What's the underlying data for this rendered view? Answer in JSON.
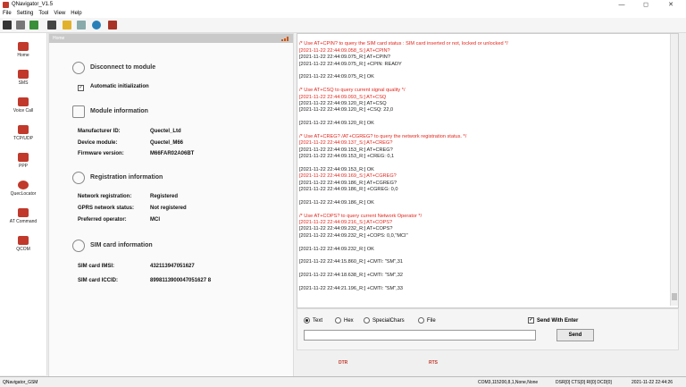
{
  "window": {
    "title": "QNavigator_V1.5",
    "minimize": "—",
    "maximize": "◻",
    "close": "✕"
  },
  "menu": [
    "File",
    "Setting",
    "Tool",
    "View",
    "Help"
  ],
  "sidebar": {
    "items": [
      {
        "label": "Home"
      },
      {
        "label": "SMS"
      },
      {
        "label": "Voice Call"
      },
      {
        "label": "TCP/UDP"
      },
      {
        "label": "PPP"
      },
      {
        "label": "QuecLocator"
      },
      {
        "label": "AT Command"
      },
      {
        "label": "QCOM"
      }
    ]
  },
  "home": {
    "header": "Home",
    "disconnect_label": "Disconnect to module",
    "auto_init_label": "Automatic initialization",
    "auto_init_checked": "✓",
    "module_info_title": "Module information",
    "module_fields": [
      {
        "label": "Manufacturer ID:",
        "value": "Quectel_Ltd"
      },
      {
        "label": "Device module:",
        "value": "Quectel_M66"
      },
      {
        "label": "Firmware version:",
        "value": "M66FAR02A06BT"
      }
    ],
    "registration_title": "Registration information",
    "registration_fields": [
      {
        "label": "Network registration:",
        "value": "Registered"
      },
      {
        "label": "GPRS network status:",
        "value": "Not registered"
      },
      {
        "label": "Preferred operator:",
        "value": "MCI"
      }
    ],
    "sim_title": "SIM card information",
    "sim_fields": [
      {
        "label": "SIM card IMSI:",
        "value": "432113947051627"
      },
      {
        "label": "SIM card ICCID:",
        "value": "8998113900047051627 8"
      }
    ]
  },
  "log": [
    {
      "c": "blk",
      "t": ""
    },
    {
      "c": "red",
      "t": "/* Use AT+CPIN? to query the SIM card status : SIM card inserted or not, locked or unlocked */"
    },
    {
      "c": "red",
      "t": "[2021-11-22 22:44:09.058_S:] AT+CPIN?"
    },
    {
      "c": "blk",
      "t": "[2021-11-22 22:44:09.075_R:] AT+CPIN?"
    },
    {
      "c": "blk",
      "t": "[2021-11-22 22:44:09.075_R:] +CPIN: READY"
    },
    {
      "c": "blk",
      "t": ""
    },
    {
      "c": "blk",
      "t": "[2021-11-22 22:44:09.075_R:] OK"
    },
    {
      "c": "blk",
      "t": ""
    },
    {
      "c": "red",
      "t": "/* Use AT+CSQ to query current signal quality */"
    },
    {
      "c": "red",
      "t": "[2021-11-22 22:44:09.093_S:] AT+CSQ"
    },
    {
      "c": "blk",
      "t": "[2021-11-22 22:44:09.120_R:] AT+CSQ"
    },
    {
      "c": "blk",
      "t": "[2021-11-22 22:44:09.120_R:] +CSQ: 22,0"
    },
    {
      "c": "blk",
      "t": ""
    },
    {
      "c": "blk",
      "t": "[2021-11-22 22:44:09.120_R:] OK"
    },
    {
      "c": "blk",
      "t": ""
    },
    {
      "c": "red",
      "t": "/* Use AT+CREG? /AT+CGREG? to query the network registration status. */"
    },
    {
      "c": "red",
      "t": "[2021-11-22 22:44:09.137_S:] AT+CREG?"
    },
    {
      "c": "blk",
      "t": "[2021-11-22 22:44:09.153_R:] AT+CREG?"
    },
    {
      "c": "blk",
      "t": "[2021-11-22 22:44:09.153_R:] +CREG: 0,1"
    },
    {
      "c": "blk",
      "t": ""
    },
    {
      "c": "blk",
      "t": "[2021-11-22 22:44:09.153_R:] OK"
    },
    {
      "c": "red",
      "t": "[2021-11-22 22:44:09.169_S:] AT+CGREG?"
    },
    {
      "c": "blk",
      "t": "[2021-11-22 22:44:09.186_R:] AT+CGREG?"
    },
    {
      "c": "blk",
      "t": "[2021-11-22 22:44:09.186_R:] +CGREG: 0,0"
    },
    {
      "c": "blk",
      "t": ""
    },
    {
      "c": "blk",
      "t": "[2021-11-22 22:44:09.186_R:] OK"
    },
    {
      "c": "blk",
      "t": ""
    },
    {
      "c": "red",
      "t": "/* Use AT+COPS? to query current Network Operator */"
    },
    {
      "c": "red",
      "t": "[2021-11-22 22:44:09.216_S:] AT+COPS?"
    },
    {
      "c": "blk",
      "t": "[2021-11-22 22:44:09.232_R:] AT+COPS?"
    },
    {
      "c": "blk",
      "t": "[2021-11-22 22:44:09.232_R:] +COPS: 0,0,\"MCI\""
    },
    {
      "c": "blk",
      "t": ""
    },
    {
      "c": "blk",
      "t": "[2021-11-22 22:44:09.232_R:] OK"
    },
    {
      "c": "blk",
      "t": ""
    },
    {
      "c": "blk",
      "t": "[2021-11-22 22:44:15.860_R:] +CMTI: \"SM\",31"
    },
    {
      "c": "blk",
      "t": ""
    },
    {
      "c": "blk",
      "t": "[2021-11-22 22:44:18.638_R:] +CMTI: \"SM\",32"
    },
    {
      "c": "blk",
      "t": ""
    },
    {
      "c": "blk",
      "t": "[2021-11-22 22:44:21.196_R:] +CMTI: \"SM\",33"
    }
  ],
  "send": {
    "modes": [
      "Text",
      "Hex",
      "SpecialChars",
      "File"
    ],
    "selected_mode": "Text",
    "send_with_enter_label": "Send With Enter",
    "send_with_enter_checked": "✓",
    "input_value": "",
    "send_label": "Send"
  },
  "signals": {
    "dtr": "DTR",
    "rts": "RTS"
  },
  "status": {
    "app": "QNavigator_GSM",
    "port": "COM3,115200,8,1,None,None",
    "lines": "DSR[0] CTS[0] RI[0] DCD[0]",
    "time": "2021-11-22 22:44:26"
  },
  "colors": {
    "accent": "#c0392b",
    "log_send": "#e0251b"
  }
}
